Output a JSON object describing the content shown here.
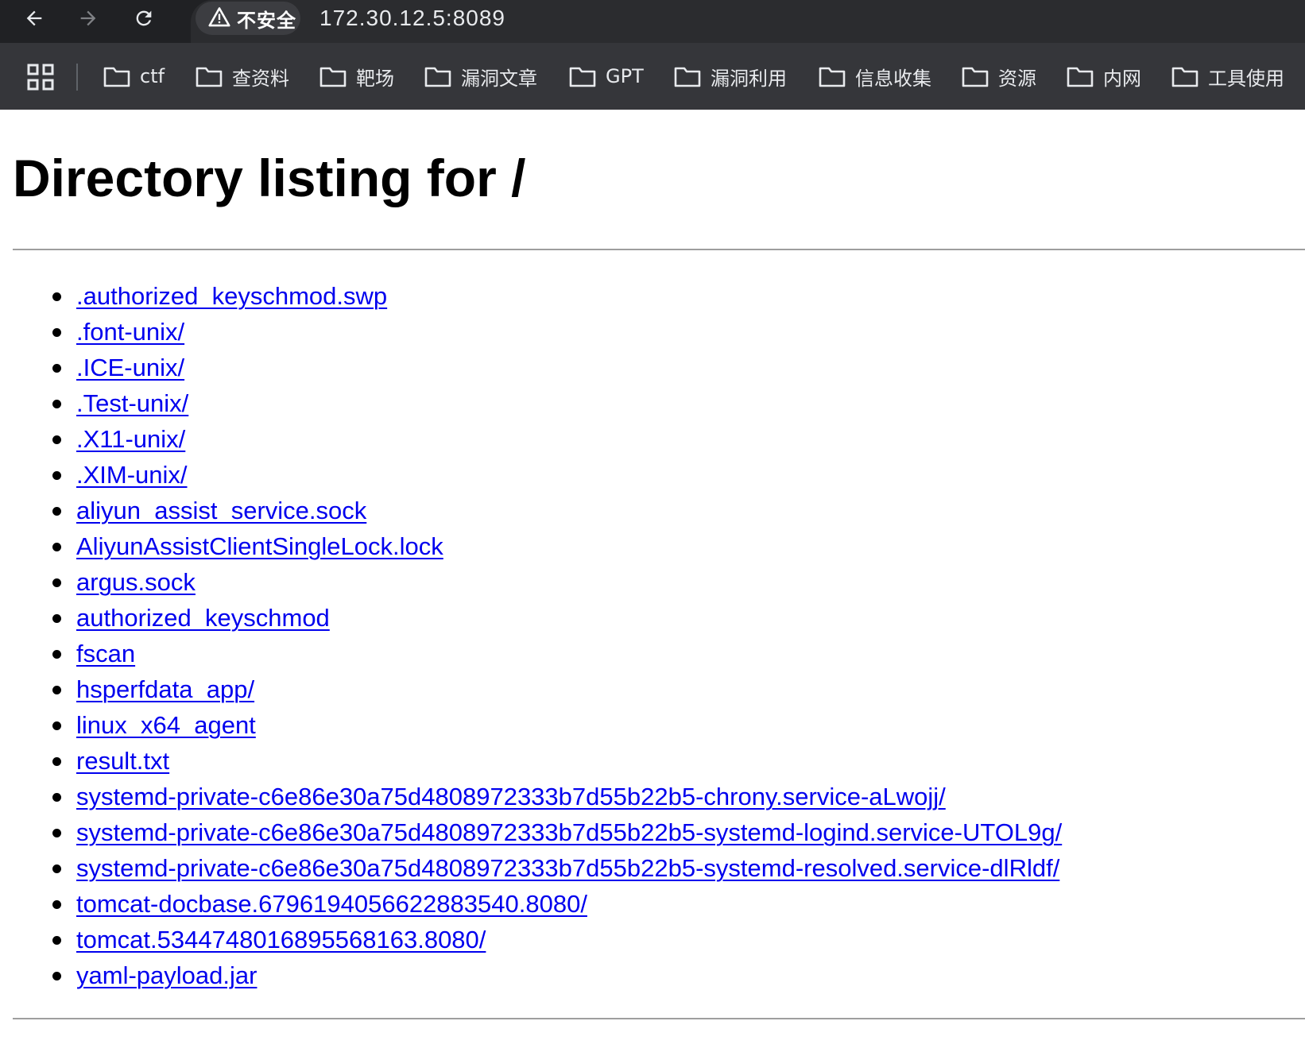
{
  "browser": {
    "security_label": "不安全",
    "url": "172.30.12.5:8089",
    "bookmarks": [
      "ctf",
      "查资料",
      "靶场",
      "漏洞文章",
      "GPT",
      "漏洞利用",
      "信息收集",
      "资源",
      "内网",
      "工具使用"
    ]
  },
  "page": {
    "title": "Directory listing for /",
    "entries": [
      ".authorized_keyschmod.swp",
      ".font-unix/",
      ".ICE-unix/",
      ".Test-unix/",
      ".X11-unix/",
      ".XIM-unix/",
      "aliyun_assist_service.sock",
      "AliyunAssistClientSingleLock.lock",
      "argus.sock",
      "authorized_keyschmod",
      "fscan",
      "hsperfdata_app/",
      "linux_x64_agent",
      "result.txt",
      "systemd-private-c6e86e30a75d4808972333b7d55b22b5-chrony.service-aLwojj/",
      "systemd-private-c6e86e30a75d4808972333b7d55b22b5-systemd-logind.service-UTOL9g/",
      "systemd-private-c6e86e30a75d4808972333b7d55b22b5-systemd-resolved.service-dlRldf/",
      "tomcat-docbase.6796194056622883540.8080/",
      "tomcat.5344748016895568163.8080/",
      "yaml-payload.jar"
    ]
  },
  "colors": {
    "link": "#0000ee",
    "chrome_dark": "#202124",
    "bookmarks_bg": "#35363a"
  }
}
